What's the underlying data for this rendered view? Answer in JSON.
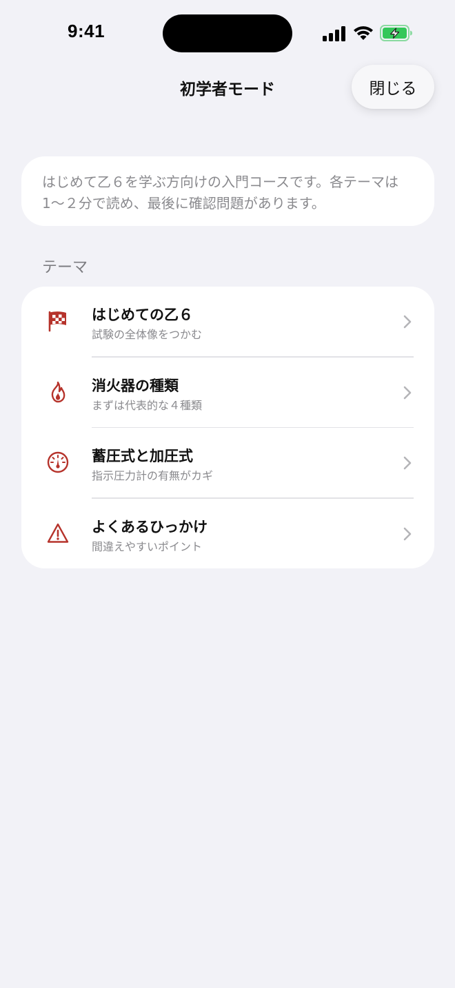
{
  "status_bar": {
    "time": "9:41"
  },
  "nav": {
    "title": "初学者モード",
    "close_label": "閉じる"
  },
  "intro": {
    "text": "はじめて乙６を学ぶ方向けの入門コースです。各テーマは1〜２分で読め、最後に確認問題があります。"
  },
  "section": {
    "header": "テーマ"
  },
  "topics": [
    {
      "icon": "checkered-flag-icon",
      "title": "はじめての乙６",
      "subtitle": "試験の全体像をつかむ"
    },
    {
      "icon": "flame-icon",
      "title": "消火器の種類",
      "subtitle": "まずは代表的な４種類"
    },
    {
      "icon": "gauge-icon",
      "title": "蓄圧式と加圧式",
      "subtitle": "指示圧力計の有無がカギ"
    },
    {
      "icon": "warning-triangle-icon",
      "title": "よくあるひっかけ",
      "subtitle": "間違えやすいポイント"
    }
  ],
  "colors": {
    "accent": "#b6332b",
    "background": "#f2f2f7",
    "card": "#ffffff",
    "secondary_text": "#8a8a8e",
    "battery_green": "#34c759"
  }
}
